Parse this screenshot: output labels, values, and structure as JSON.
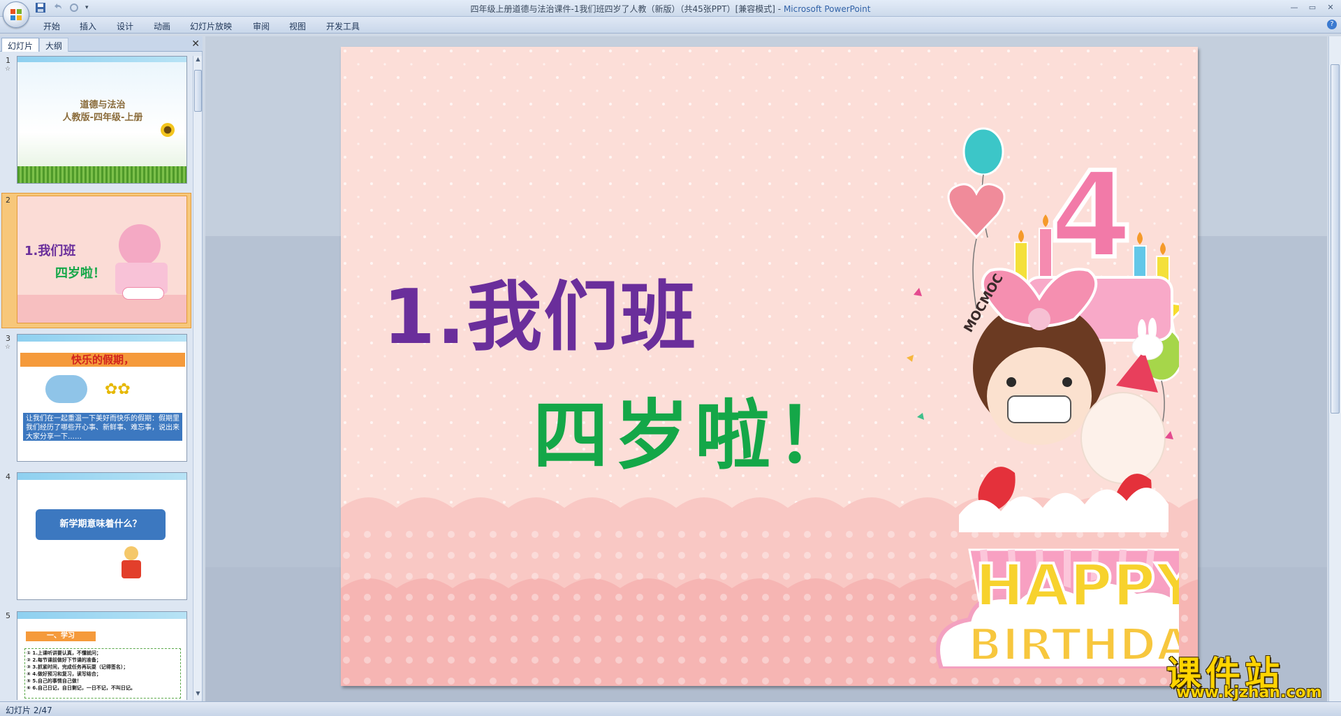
{
  "window": {
    "title": "四年级上册道德与法治课件-1我们班四岁了人教（新版）（共45张PPT）[兼容模式]",
    "app_name": "Microsoft PowerPoint"
  },
  "ribbon": {
    "tabs": [
      "开始",
      "插入",
      "设计",
      "动画",
      "幻灯片放映",
      "审阅",
      "视图",
      "开发工具"
    ]
  },
  "left_panel": {
    "tab_slides": "幻灯片",
    "tab_outline": "大纲",
    "close_glyph": "✕",
    "thumbnails": [
      {
        "number": "1",
        "lines": [
          "道德与法治",
          "人教版-四年级-上册"
        ]
      },
      {
        "number": "2",
        "lines": [
          "1.我们班",
          "四岁啦！"
        ],
        "selected": true
      },
      {
        "number": "3",
        "lines": [
          "快乐的假期，",
          "让我们在一起重温一下美好而快乐的假期：假期里我们经历了哪些开心事、新鲜事、难忘事，说出来大家分享一下……"
        ]
      },
      {
        "number": "4",
        "lines": [
          "新学期意味着什么？"
        ]
      },
      {
        "number": "5",
        "lines": [
          "一、学习",
          "① 1.上课听讲要认真，不懂就问；",
          "② 2.每节课前做好下节课的准备；",
          "③ 3.抓紧时间，完成任务再玩耍（记得签名）；",
          "④ 4.做好预习和复习，读写结合；",
          "⑤ 5.自己的事情自己做！",
          "⑥ 6.自己日记，自日剩记，一日不记，不叫日记。"
        ]
      }
    ]
  },
  "slide": {
    "title_line1": "1.我们班",
    "title_line2": "四岁啦！",
    "cake_number": "4",
    "brand": "MOCMOC",
    "happy": "HAPPY",
    "birthday": "BIRTHDAY"
  },
  "watermark": {
    "cn": "课件站",
    "url": "www.kjzhan.com"
  },
  "statusbar": {
    "slide_indicator": "幻灯片 2/47"
  },
  "colors": {
    "title_purple": "#6a2e9b",
    "title_green": "#14a748",
    "slide_bg": "#fbd9d4",
    "selection": "#f7c77a"
  }
}
